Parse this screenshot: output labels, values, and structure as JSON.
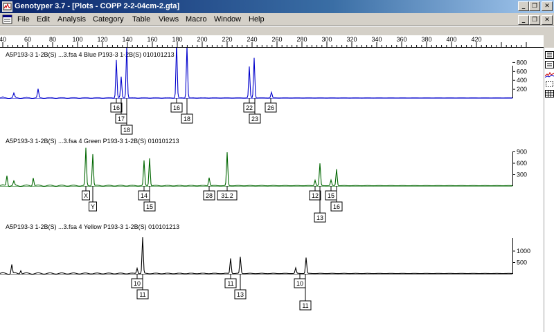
{
  "window": {
    "title": "Genotyper 3.7  - [Plots - COPP 2-2-04cm-2.gta]",
    "min_label": "_",
    "max_label": "❐",
    "close_label": "✕"
  },
  "menu": [
    {
      "key": "file",
      "label": "File"
    },
    {
      "key": "edit",
      "label": "Edit"
    },
    {
      "key": "analysis",
      "label": "Analysis"
    },
    {
      "key": "category",
      "label": "Category"
    },
    {
      "key": "table",
      "label": "Table"
    },
    {
      "key": "views",
      "label": "Views"
    },
    {
      "key": "macro",
      "label": "Macro"
    },
    {
      "key": "window",
      "label": "Window"
    },
    {
      "key": "help",
      "label": "Help"
    }
  ],
  "ruler": {
    "ticks": [
      "40",
      "60",
      "80",
      "100",
      "120",
      "140",
      "160",
      "180",
      "200",
      "220",
      "240",
      "260",
      "280",
      "300",
      "320",
      "340",
      "360",
      "380",
      "400",
      "420"
    ]
  },
  "tools": [
    "zoom-in-icon",
    "zoom-out-icon",
    "trace-icon",
    "select-box-icon",
    "table-icon"
  ],
  "panels": [
    {
      "key": "blue",
      "header": "A5P193-3  1-2B(S) ...3.fsa  4 Blue    P193-3  1-2B(S)  010101213",
      "color": "#0000cc",
      "yticks": [
        "800",
        "600",
        "400",
        "200"
      ],
      "labels": [
        {
          "text": "16",
          "row": 1
        },
        {
          "text": "17",
          "row": 2
        },
        {
          "text": "18",
          "row": 3
        },
        {
          "text": "16",
          "row": 1
        },
        {
          "text": "18",
          "row": 2
        },
        {
          "text": "22",
          "row": 1
        },
        {
          "text": "23",
          "row": 2
        },
        {
          "text": "26",
          "row": 1
        }
      ]
    },
    {
      "key": "green",
      "header": "A5P193-3  1-2B(S) ...3.fsa  4 Green    P193-3  1-2B(S)  010101213",
      "color": "#006600",
      "yticks": [
        "900",
        "600",
        "300"
      ],
      "labels": [
        {
          "text": "X",
          "row": 1
        },
        {
          "text": "Y",
          "row": 2
        },
        {
          "text": "14",
          "row": 1
        },
        {
          "text": "15",
          "row": 2
        },
        {
          "text": "28",
          "row": 1
        },
        {
          "text": "31.2",
          "row": 1
        },
        {
          "text": "12",
          "row": 1
        },
        {
          "text": "13",
          "row": 3
        },
        {
          "text": "15",
          "row": 1
        },
        {
          "text": "16",
          "row": 2
        }
      ]
    },
    {
      "key": "yellow",
      "header": "A5P193-3  1-2B(S) ...3.fsa  4 Yellow    P193-3  1-2B(S)  010101213",
      "color": "#000000",
      "yticks": [
        "1000",
        "500"
      ],
      "labels": [
        {
          "text": "10",
          "row": 1
        },
        {
          "text": "11",
          "row": 2
        },
        {
          "text": "11",
          "row": 1
        },
        {
          "text": "13",
          "row": 2
        },
        {
          "text": "10",
          "row": 1
        },
        {
          "text": "11",
          "row": 3
        }
      ]
    }
  ]
}
